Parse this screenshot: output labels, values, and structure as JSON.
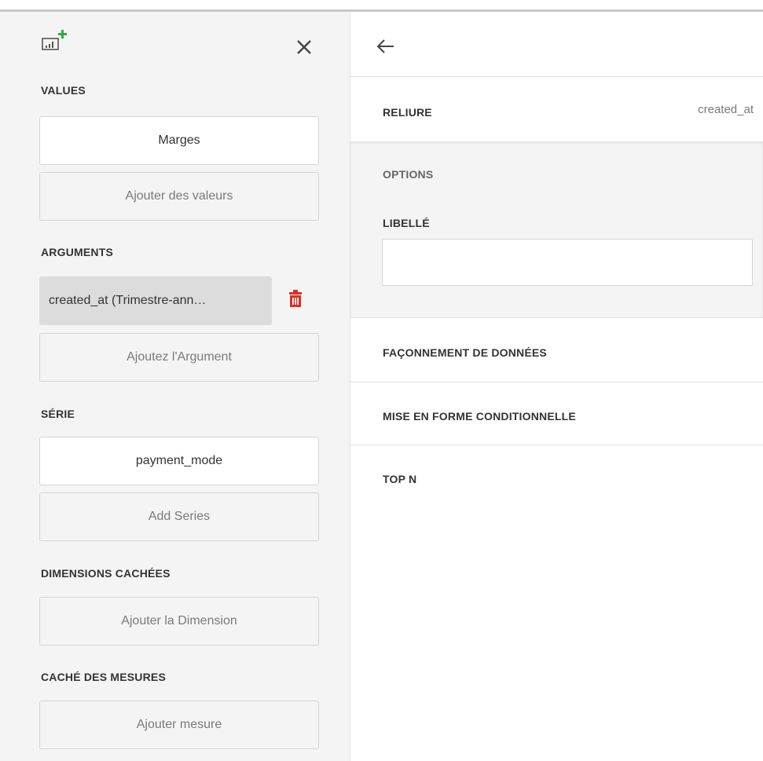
{
  "left_panel": {
    "icons": {
      "chart_add": "chart-add-icon",
      "close": "close-icon",
      "delete": "trash-icon"
    },
    "values": {
      "title": "VALUES",
      "item": "Marges",
      "add_label": "Ajouter des valeurs"
    },
    "arguments": {
      "title": "ARGUMENTS",
      "item": "created_at (Trimestre-ann…",
      "add_label": "Ajoutez l'Argument"
    },
    "series": {
      "title": "SÉRIE",
      "item": "payment_mode",
      "add_label": "Add Series"
    },
    "hidden_dimensions": {
      "title": "DIMENSIONS CACHÉES",
      "add_label": "Ajouter la Dimension"
    },
    "hidden_measures": {
      "title": "CACHÉ DES MESURES",
      "add_label": "Ajouter mesure"
    }
  },
  "right_panel": {
    "icons": {
      "back": "back-arrow-icon"
    },
    "binding": {
      "label": "RELIURE",
      "value": "created_at"
    },
    "options": {
      "title": "OPTIONS",
      "label_field": {
        "label": "LIBELLÉ",
        "value": "",
        "placeholder": ""
      }
    },
    "sections": [
      {
        "label": "FAÇONNEMENT DE DONNÉES"
      },
      {
        "label": "MISE EN FORME CONDITIONNELLE"
      },
      {
        "label": "TOP N"
      }
    ]
  },
  "colors": {
    "accent_green": "#2eaa3f",
    "delete_red": "#d93025",
    "panel_bg": "#f4f4f4"
  }
}
